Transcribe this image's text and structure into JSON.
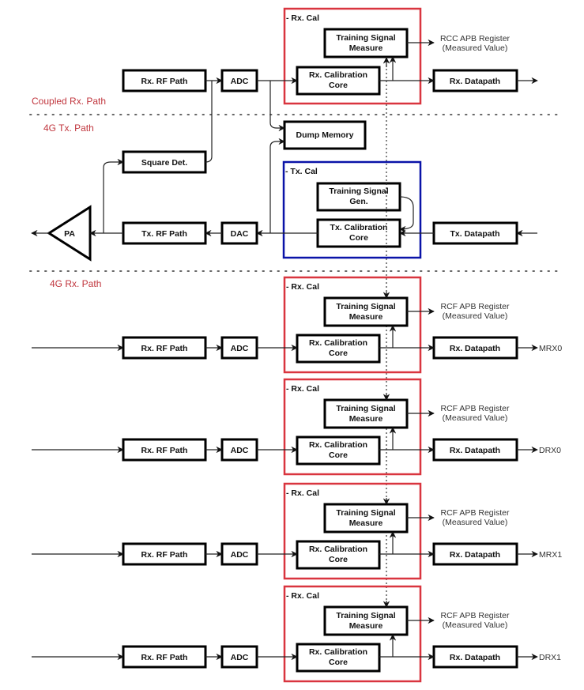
{
  "sections": {
    "coupled_rx": "Coupled Rx. Path",
    "tx": "4G Tx. Path",
    "rx": "4G Rx. Path"
  },
  "coupled": {
    "rf_path": "Rx. RF Path",
    "adc": "ADC",
    "cal_group": "- Rx. Cal",
    "tsm_line1": "Training Signal",
    "tsm_line2": "Measure",
    "core_line1": "Rx. Calibration",
    "core_line2": "Core",
    "datapath": "Rx. Datapath",
    "register_line1": "RCC APB Register",
    "register_line2": "(Measured Value)"
  },
  "tx": {
    "dump_memory": "Dump Memory",
    "square_det": "Square Det.",
    "cal_group": "- Tx. Cal",
    "tsg_line1": "Training Signal",
    "tsg_line2": "Gen.",
    "core_line1": "Tx. Calibration",
    "core_line2": "Core",
    "datapath": "Tx. Datapath",
    "dac": "DAC",
    "rf_path": "Tx. RF Path",
    "pa": "PA"
  },
  "rx_chains": [
    {
      "rf_path": "Rx. RF Path",
      "adc": "ADC",
      "cal_group": "- Rx. Cal",
      "tsm_line1": "Training Signal",
      "tsm_line2": "Measure",
      "core_line1": "Rx. Calibration",
      "core_line2": "Core",
      "datapath": "Rx. Datapath",
      "register_line1": "RCF APB Register",
      "register_line2": "(Measured Value)",
      "output": "MRX0"
    },
    {
      "rf_path": "Rx. RF Path",
      "adc": "ADC",
      "cal_group": "- Rx. Cal",
      "tsm_line1": "Training Signal",
      "tsm_line2": "Measure",
      "core_line1": "Rx. Calibration",
      "core_line2": "Core",
      "datapath": "Rx. Datapath",
      "register_line1": "RCF APB Register",
      "register_line2": "(Measured Value)",
      "output": "DRX0"
    },
    {
      "rf_path": "Rx. RF Path",
      "adc": "ADC",
      "cal_group": "- Rx. Cal",
      "tsm_line1": "Training Signal",
      "tsm_line2": "Measure",
      "core_line1": "Rx. Calibration",
      "core_line2": "Core",
      "datapath": "Rx. Datapath",
      "register_line1": "RCF APB Register",
      "register_line2": "(Measured Value)",
      "output": "MRX1"
    },
    {
      "rf_path": "Rx. RF Path",
      "adc": "ADC",
      "cal_group": "- Rx. Cal",
      "tsm_line1": "Training Signal",
      "tsm_line2": "Measure",
      "core_line1": "Rx. Calibration",
      "core_line2": "Core",
      "datapath": "Rx. Datapath",
      "register_line1": "RCF APB Register",
      "register_line2": "(Measured Value)",
      "output": "DRX1"
    }
  ],
  "colors": {
    "rx_cal_border": "#d9353f",
    "tx_cal_border": "#0a13a8",
    "section_label": "#c0353d"
  }
}
